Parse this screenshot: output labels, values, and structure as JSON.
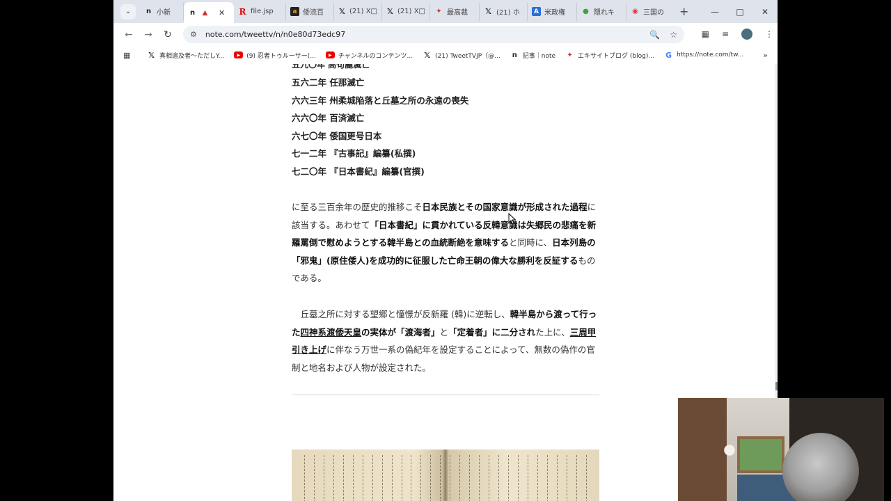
{
  "browser": {
    "tabs": [
      {
        "icon": "n",
        "title": "小新",
        "active": false
      },
      {
        "icon": "n",
        "title": "",
        "active": true
      },
      {
        "icon": "R",
        "title": "file.jsp",
        "active": false
      },
      {
        "icon": "a",
        "title": "倭流百",
        "active": false
      },
      {
        "icon": "X",
        "title": "(21) X□",
        "active": false
      },
      {
        "icon": "X",
        "title": "(21) X□",
        "active": false
      },
      {
        "icon": "e",
        "title": "最高裁",
        "active": false
      },
      {
        "icon": "X",
        "title": "(21) ホ",
        "active": false
      },
      {
        "icon": "A",
        "title": "米政権",
        "active": false
      },
      {
        "icon": "g",
        "title": "隠れキ",
        "active": false
      },
      {
        "icon": "map",
        "title": "三国の",
        "active": false
      }
    ],
    "new_tab": "+",
    "url": "note.com/tweettv/n/n0e80d73edc97",
    "bookmarks": [
      {
        "icon": "X",
        "label": "真相追及者～ただしY..."
      },
      {
        "icon": "yt",
        "label": "(9) 忍者トゥルーサー(..."
      },
      {
        "icon": "yt",
        "label": "チャンネルのコンテンツ..."
      },
      {
        "icon": "X",
        "label": "(21) TweetTVJP（@..."
      },
      {
        "icon": "n",
        "label": "記事｜note"
      },
      {
        "icon": "e",
        "label": "エキサイトブログ (blog)..."
      },
      {
        "icon": "G",
        "label": "https://note.com/tw..."
      }
    ]
  },
  "article": {
    "cut_line": "五九〇年 高句麗滅亡",
    "chronology": [
      "五六二年 任那滅亡",
      "六六三年 州柔城陥落と丘墓之所の永遠の喪失",
      "六六〇年 百済滅亡",
      "六七〇年 倭国更号日本",
      "七一二年 『古事記』編纂(私撰)",
      "七二〇年 『日本書紀』編纂(官撰)"
    ],
    "para1": {
      "t1": "に至る三百余年の歴史的推移こそ",
      "b1": "日本民族とその国家意識が形成された過程",
      "t2": "に該当する。あわせて",
      "b2": "「日本書紀」に貫かれている反韓意識は失郷民の悲痛を新羅罵倒で慰めようとする韓半島との血統断絶を意味する",
      "t3": "と同時に、",
      "b3": "日本列島の「邪鬼」(原住倭人)を成功的に征服した亡命王朝の偉大な勝利を反証する",
      "t4": "ものである。"
    },
    "para2": {
      "t1": "　丘墓之所に対する望郷と憧憬が反新羅 (韓)に逆転し、",
      "b1": "韓半島から渡って行った",
      "bu1": "四神系渡倭天皇",
      "b2": "の実体が「渡海者」",
      "t2": "と",
      "b3": "「定着者」に二分され",
      "t3": "た上に、",
      "u1": "三周甲引き上げ",
      "t4": "に伴なう万世一系の偽紀年を設定することによって、無数の偽作の官制と地名および人物が設定された。"
    }
  }
}
